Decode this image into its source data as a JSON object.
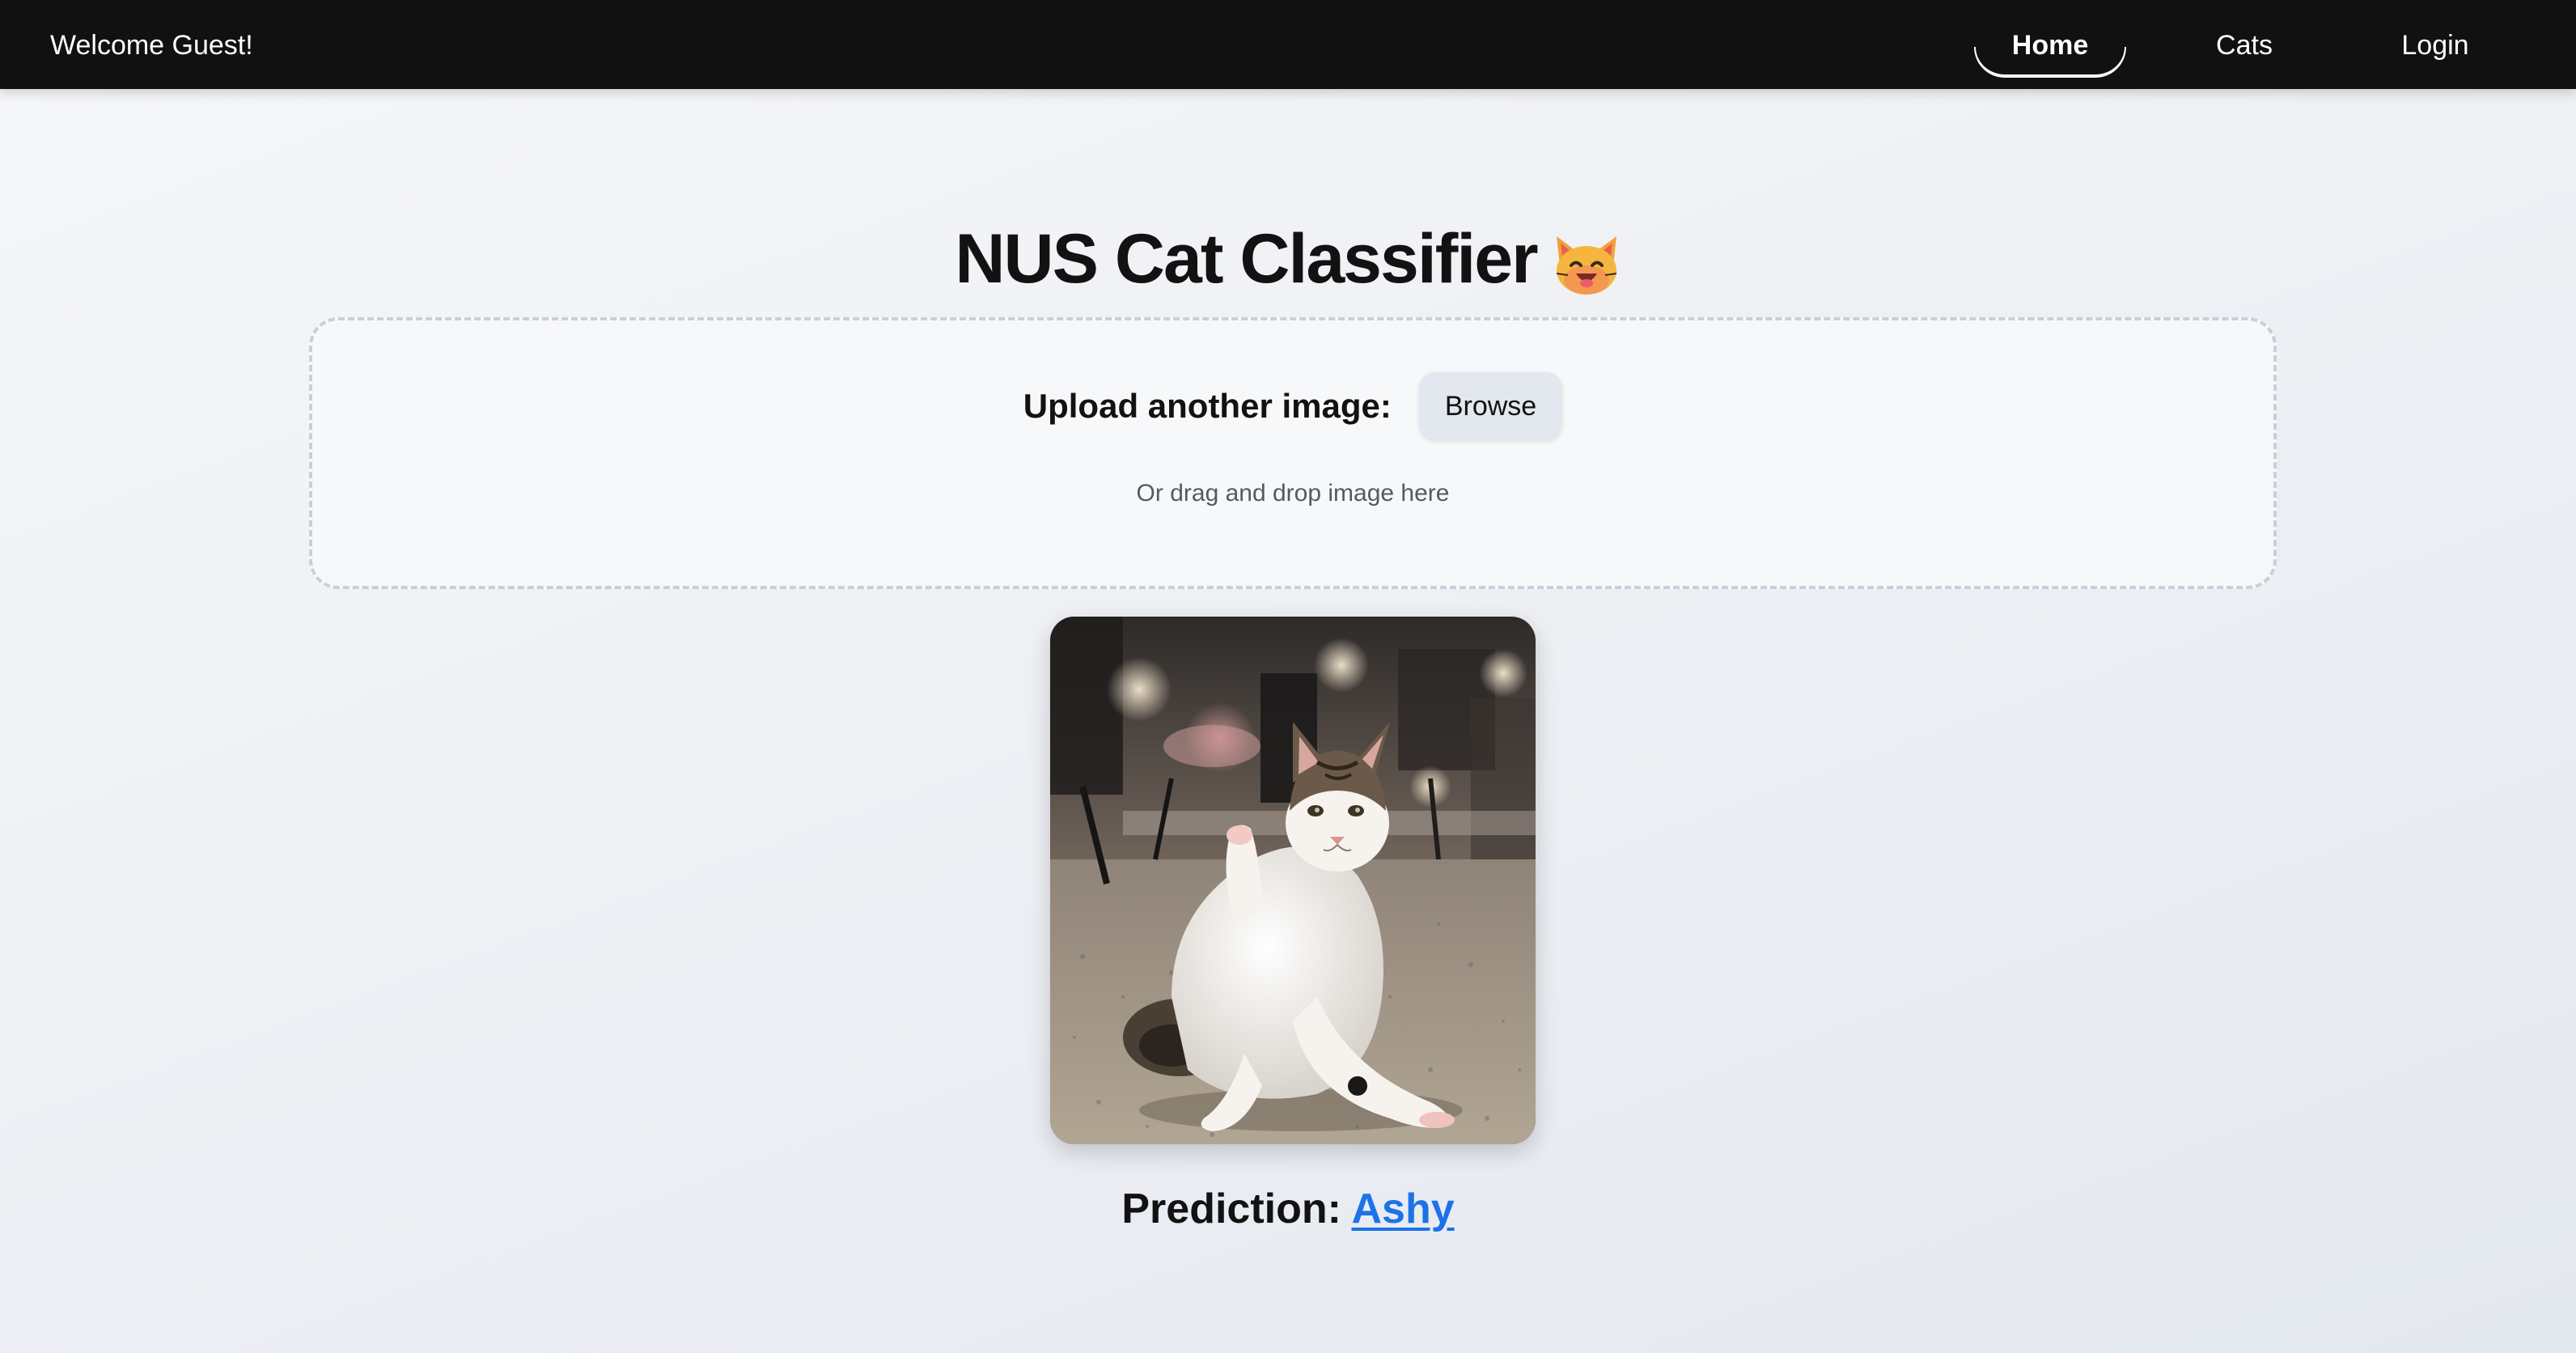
{
  "navbar": {
    "welcome_text": "Welcome Guest!",
    "links": [
      {
        "label": "Home",
        "active": true
      },
      {
        "label": "Cats",
        "active": false
      },
      {
        "label": "Login",
        "active": false
      }
    ]
  },
  "main": {
    "title": "NUS Cat Classifier",
    "title_icon": "grinning-cat-face-emoji",
    "upload": {
      "label": "Upload another image:",
      "browse_label": "Browse",
      "hint": "Or drag and drop image here"
    },
    "image": {
      "subject": "white and tabby cat sitting on carpet, grooming with raised paw"
    },
    "prediction": {
      "label": "Prediction:",
      "value": "Ashy"
    }
  },
  "colors": {
    "navbar_bg": "#111111",
    "page_bg": "#eef0f4",
    "dropzone_border": "#c9cfd8",
    "button_bg": "#e3e7ee",
    "link": "#1d72e8",
    "text": "#121212"
  }
}
